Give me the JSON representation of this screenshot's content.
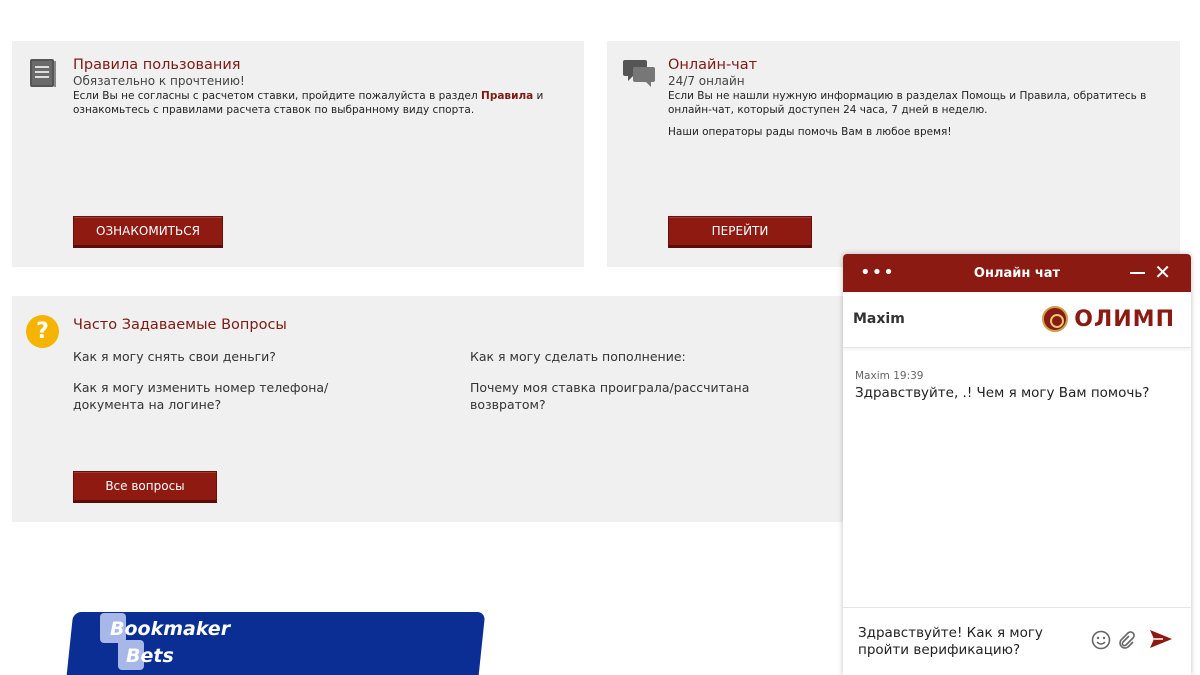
{
  "rules_card": {
    "title": "Правила пользования",
    "subtitle": "Обязательно к прочтению!",
    "text_before": "Если Вы не согласны с расчетом ставки, пройдите пожалуйста в раздел ",
    "text_link": "Правила",
    "text_after": " и ознакомьтесь с правилами расчета ставок по выбранному виду спорта.",
    "button_label": "ОЗНАКОМИТЬСЯ",
    "icon": "book-icon"
  },
  "chat_card": {
    "title": "Онлайн-чат",
    "subtitle": "24/7 онлайн",
    "text1": "Если Вы не нашли нужную информацию в разделах Помощь и Правила, обратитесь в онлайн-чат, который доступен 24 часа, 7 дней в неделю.",
    "text2": "Наши операторы рады помочь Вам в любое время!",
    "button_label": "ПЕРЕЙТИ",
    "icon": "chat-bubbles-icon"
  },
  "faq_card": {
    "title": "Часто Задаваемые Вопросы",
    "questions": [
      "Как я могу снять свои деньги?",
      "Как я могу сделать пополнение:",
      "Как я могу изменить номер телефона/документа на логине?",
      "Почему моя ставка проиграла/рассчитана возвратом?"
    ],
    "button_label": "Все вопросы",
    "icon": "question-icon"
  },
  "chat_widget": {
    "title": "Онлайн чат",
    "agent_name": "Maxim",
    "brand": "ОЛИМП",
    "message": {
      "author": "Maxim",
      "time": "19:39",
      "text": "Здравствуйте, .! Чем я могу Вам помочь?"
    },
    "input_value": "Здравствуйте! Как я могу пройти верификацию?"
  },
  "watermark": {
    "line1": "Bookmaker",
    "line2": "Bets"
  },
  "colors": {
    "accent": "#8b1a12",
    "card_bg": "#f0f0f0",
    "faq_icon": "#f5b400",
    "watermark_bg": "#0a2e93"
  }
}
